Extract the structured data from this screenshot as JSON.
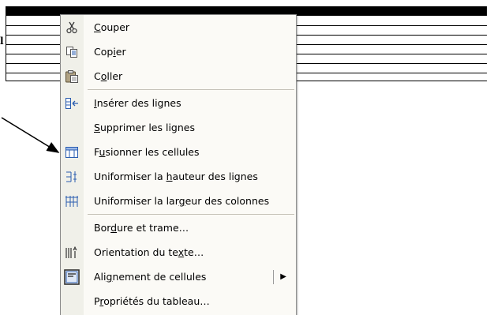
{
  "document": {
    "cell_marker": "l"
  },
  "menu": {
    "items": [
      {
        "id": "couper",
        "pre": "",
        "key": "C",
        "post": "ouper",
        "icon": "scissors-icon"
      },
      {
        "id": "copier",
        "pre": "Cop",
        "key": "i",
        "post": "er",
        "icon": "copy-icon"
      },
      {
        "id": "coller",
        "pre": "C",
        "key": "o",
        "post": "ller",
        "icon": "paste-icon"
      },
      {
        "id": "inserer",
        "pre": "",
        "key": "I",
        "post": "nsérer des lignes",
        "icon": "insert-rows-icon"
      },
      {
        "id": "supprimer",
        "pre": "",
        "key": "S",
        "post": "upprimer les lignes",
        "icon": ""
      },
      {
        "id": "fusionner",
        "pre": "F",
        "key": "u",
        "post": "sionner les cellules",
        "icon": "merge-cells-icon"
      },
      {
        "id": "uniform-hauteur",
        "pre": "Uniformiser la ",
        "key": "h",
        "post": "auteur des lignes",
        "icon": "distribute-rows-icon"
      },
      {
        "id": "uniform-largeur",
        "pre": "Uniformiser la lar",
        "key": "g",
        "post": "eur des colonnes",
        "icon": "distribute-columns-icon"
      },
      {
        "id": "bordure",
        "pre": "Bor",
        "key": "d",
        "post": "ure et trame…",
        "icon": ""
      },
      {
        "id": "orientation",
        "pre": "Orientation du te",
        "key": "x",
        "post": "te…",
        "icon": "text-direction-icon"
      },
      {
        "id": "alignement",
        "pre": "Ali",
        "key": "g",
        "post": "nement de cellules",
        "icon": "cell-alignment-icon"
      },
      {
        "id": "proprietes",
        "pre": "P",
        "key": "r",
        "post": "opriétés du tableau…",
        "icon": ""
      }
    ]
  }
}
